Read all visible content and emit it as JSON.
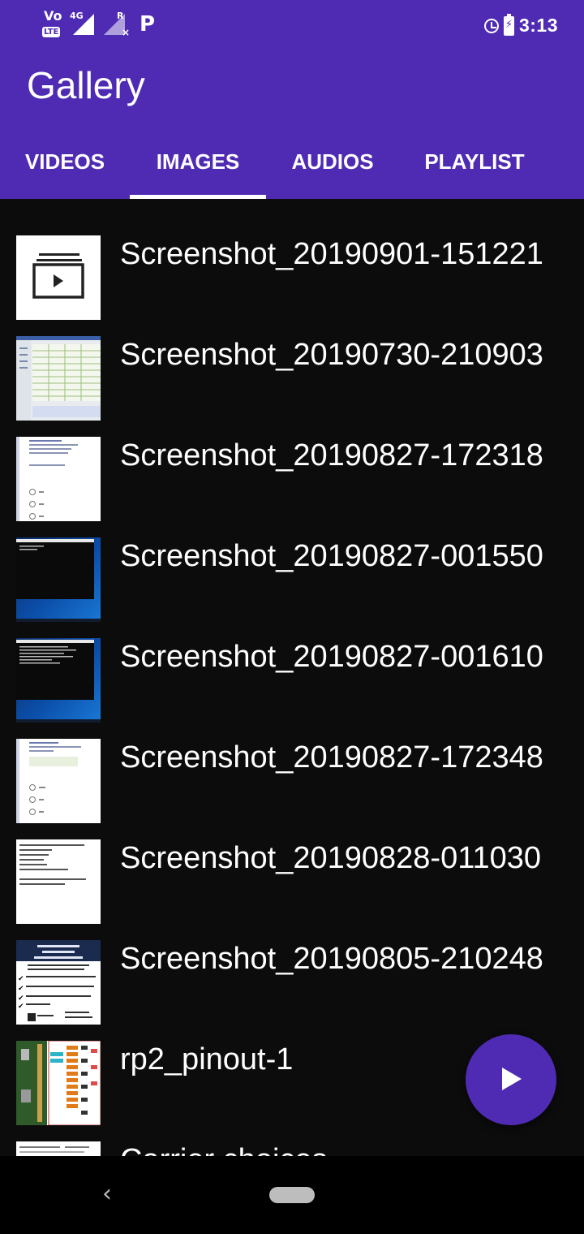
{
  "status_bar": {
    "network_4g": "4G",
    "network_r": "R",
    "time": "3:13",
    "icons": [
      "volte-icon",
      "signal-4g-icon",
      "signal-roaming-icon",
      "p-app-icon",
      "alarm-icon",
      "battery-charging-icon"
    ]
  },
  "app": {
    "title": "Gallery"
  },
  "tabs": [
    {
      "label": "VIDEOS",
      "selected": false
    },
    {
      "label": "IMAGES",
      "selected": true
    },
    {
      "label": "AUDIOS",
      "selected": false
    },
    {
      "label": "PLAYLIST",
      "selected": false
    }
  ],
  "items": [
    {
      "name": "Screenshot_20190901-151221",
      "thumb": "video-placeholder"
    },
    {
      "name": "Screenshot_20190730-210903",
      "thumb": "spreadsheet"
    },
    {
      "name": "Screenshot_20190827-172318",
      "thumb": "form"
    },
    {
      "name": "Screenshot_20190827-001550",
      "thumb": "desktop-terminal"
    },
    {
      "name": "Screenshot_20190827-001610",
      "thumb": "desktop-terminal"
    },
    {
      "name": "Screenshot_20190827-172348",
      "thumb": "form"
    },
    {
      "name": "Screenshot_20190828-011030",
      "thumb": "text"
    },
    {
      "name": "Screenshot_20190805-210248",
      "thumb": "poster"
    },
    {
      "name": "rp2_pinout-1",
      "thumb": "pinout"
    },
    {
      "name": "Carrier choices",
      "thumb": "document"
    }
  ],
  "colors": {
    "accent": "#4f2bb3",
    "background": "#0c0c0c",
    "text": "#ffffff"
  },
  "fab": {
    "icon": "play-icon"
  },
  "nav": {
    "icons": [
      "back-icon",
      "home-pill-icon"
    ]
  }
}
